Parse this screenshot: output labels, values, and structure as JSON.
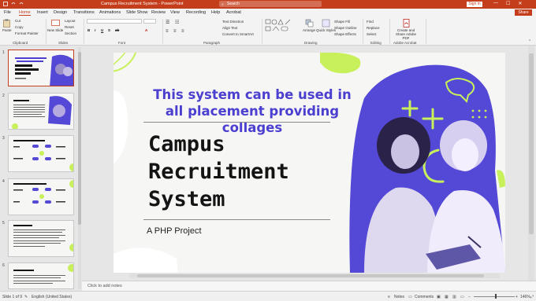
{
  "app": {
    "title": "Campus Recruitment System  -  PowerPoint",
    "search_placeholder": "Search",
    "sign_in": "Sign in",
    "share": "Share",
    "colors": {
      "accent": "#c43e1c",
      "slide_purple": "#4b3fd0",
      "lime": "#c8f05a"
    }
  },
  "menu": {
    "tabs": [
      "File",
      "Home",
      "Insert",
      "Design",
      "Transitions",
      "Animations",
      "Slide Show",
      "Review",
      "View",
      "Recording",
      "Help",
      "Acrobat"
    ],
    "active": "Home"
  },
  "ribbon": {
    "paste": "Paste",
    "cut": "Cut",
    "copy": "Copy",
    "format_painter": "Format Painter",
    "new_slide": "New Slide",
    "layout": "Layout",
    "reset": "Reset",
    "section": "Section",
    "text_direction": "Text Direction",
    "align_text": "Align Text",
    "convert_smartart": "Convert to SmartArt",
    "arrange": "Arrange",
    "quick_styles": "Quick Styles",
    "shape_fill": "Shape Fill",
    "shape_outline": "Shape Outline",
    "shape_effects": "Shape Effects",
    "find": "Find",
    "replace": "Replace",
    "select": "Select",
    "create_share_pdf": "Create and Share Adobe PDF",
    "groups": {
      "clipboard": "Clipboard",
      "slides": "Slides",
      "font": "Font",
      "paragraph": "Paragraph",
      "drawing": "Drawing",
      "editing": "Editing",
      "adobe": "Adobe Acrobat"
    }
  },
  "thumbnails": [
    {
      "num": "1",
      "title": "Campus Recruitment System"
    },
    {
      "num": "2",
      "title": "Abstract"
    },
    {
      "num": "3",
      "title": "Software Requirements"
    },
    {
      "num": "4",
      "title": "Hardware Requirements"
    },
    {
      "num": "5",
      "title": "Advantages"
    },
    {
      "num": "6",
      "title": "Disadvantages"
    }
  ],
  "slide": {
    "subtitle": "This system can be used in all placement providing collages",
    "title_lines": [
      "Campus",
      "Recruitment",
      "System"
    ],
    "tagline": "A PHP Project"
  },
  "notes": {
    "placeholder": "Click to add notes"
  },
  "status": {
    "slide_of": "Slide 1 of 9",
    "language": "English (United States)",
    "notes": "Notes",
    "comments": "Comments",
    "zoom": "146%"
  }
}
